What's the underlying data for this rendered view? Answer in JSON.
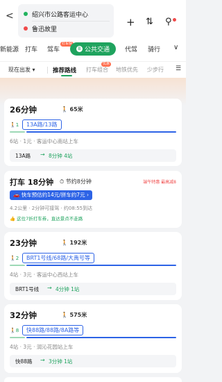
{
  "header": {
    "back_glyph": "<",
    "origin": "绍兴市公路客运中心",
    "destination": "鲁迅故里",
    "plus_glyph": "+",
    "swap_glyph": "⇅",
    "mic_glyph": "⚲"
  },
  "modes": {
    "energy": "新能源",
    "taxi": "打车",
    "drive": "驾车",
    "drive_badge": "打车快",
    "transit": "公共交通",
    "transit_icon": "B",
    "chauffeur": "代驾",
    "bike": "骑行",
    "more": "∨"
  },
  "filters": {
    "depart": "现在出发 ▾",
    "recommended": "推荐路线",
    "taxi_combo": "打车组合",
    "taxi_badge": "优惠",
    "subway_first": "地铁优先",
    "less_walk": "少步行",
    "menu": "☰"
  },
  "routes": [
    {
      "duration": "26分钟",
      "walk": "65米",
      "walk_icon": "🚶1",
      "lines": "13A路/13路",
      "meta": "6站 · 1元 · 客运中心南站上车",
      "bar_line": "13A路",
      "bar_arrow": "→",
      "bar_depart": "8分钟 4站"
    },
    {
      "duration": "23分钟",
      "walk": "192米",
      "walk_icon": "🚶2",
      "lines": "BRT1号线/68路/大禹号等",
      "meta": "4站 · 3元 · 客运中心西站上车",
      "bar_line": "BRT1号线",
      "bar_arrow": "→",
      "bar_depart": "4分钟 1站"
    },
    {
      "duration": "32分钟",
      "walk": "575米",
      "walk_icon": "🚶8",
      "lines": "快88路/88路/8A路等",
      "meta": "4站 · 3元 · 润沁花园站上车",
      "bar_line": "快88路",
      "bar_arrow": "→",
      "bar_depart": "3分钟 1站"
    }
  ],
  "taxi_option": {
    "title": "打车 18分钟",
    "save": "⏱ 节约8分钟",
    "promo": "端午特惠 最高减8",
    "price": "🚗 快车预估约14元/拼车约7元 ›",
    "meta": "4.2公里 · 2分钟可接驾 · 约08:55到达",
    "tip": "👍 这位7折打车券，直达景点不走路"
  }
}
